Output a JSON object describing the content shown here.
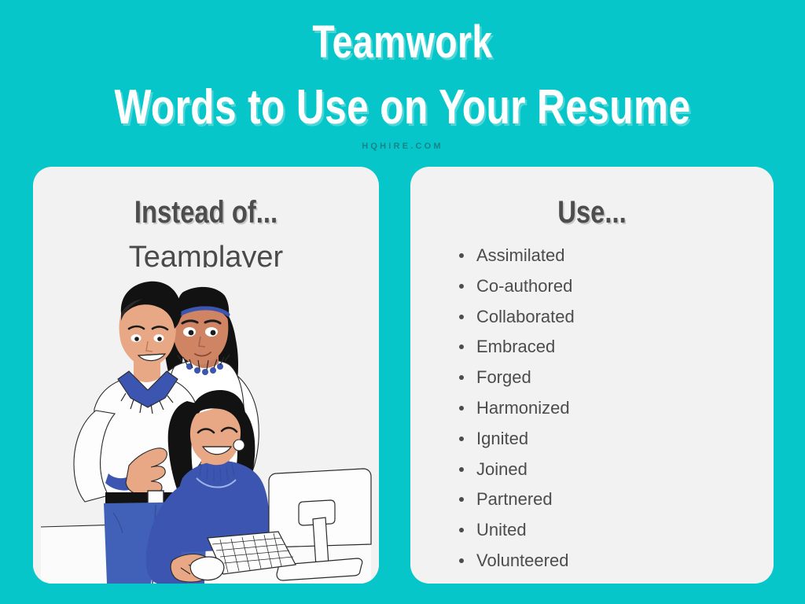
{
  "theme": {
    "background_color": "#06c6c9",
    "card_color": "#f2f2f2",
    "heading_color": "#4d4d4d",
    "text_color": "#4c4c4c",
    "title_color": "#ffffff",
    "accent_blue": "#4161b8"
  },
  "header": {
    "title": "Teamwork",
    "subtitle": "Words to Use on Your Resume",
    "watermark": "HQHIRE.COM"
  },
  "left_card": {
    "heading": "Instead of...",
    "term": "Teamplayer",
    "illustration_name": "team-at-computer-illustration"
  },
  "right_card": {
    "heading": "Use...",
    "words": [
      "Assimilated",
      "Co-authored",
      "Collaborated",
      "Embraced",
      "Forged",
      "Harmonized",
      "Ignited",
      "Joined",
      "Partnered",
      "United",
      "Volunteered"
    ]
  }
}
